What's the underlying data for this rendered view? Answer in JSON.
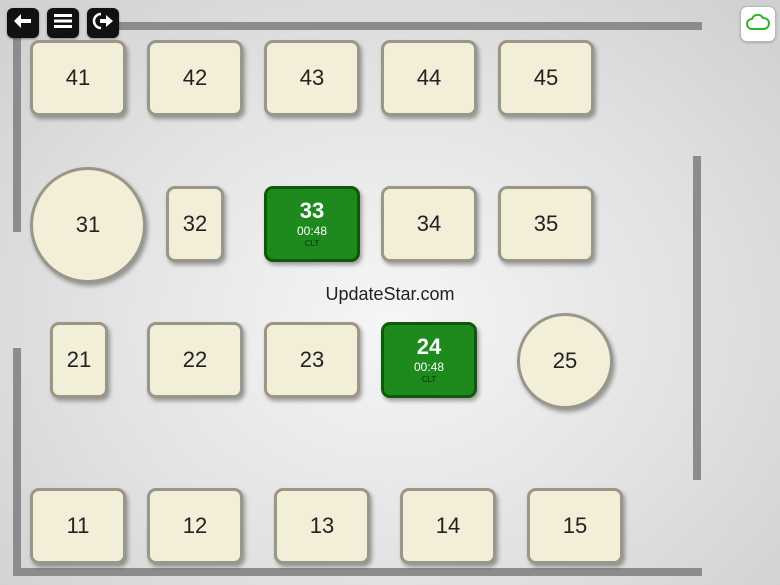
{
  "toolbar": {
    "back_icon": "back-arrow-icon",
    "menu_icon": "menu-icon",
    "exit_icon": "exit-icon",
    "sync_icon": "cloud-icon",
    "sync_color": "#2fb32f"
  },
  "watermark": "UpdateStar.com",
  "colors": {
    "table_free": "#f3eed7",
    "table_occupied": "#1e8a1e",
    "wall": "#8c8c8c"
  },
  "tables": {
    "t41": {
      "number": "41"
    },
    "t42": {
      "number": "42"
    },
    "t43": {
      "number": "43"
    },
    "t44": {
      "number": "44"
    },
    "t45": {
      "number": "45"
    },
    "t31": {
      "number": "31"
    },
    "t32": {
      "number": "32"
    },
    "t33": {
      "number": "33",
      "time": "00:48",
      "tag": "CLT"
    },
    "t34": {
      "number": "34"
    },
    "t35": {
      "number": "35"
    },
    "t21": {
      "number": "21"
    },
    "t22": {
      "number": "22"
    },
    "t23": {
      "number": "23"
    },
    "t24": {
      "number": "24",
      "time": "00:48",
      "tag": "CLT"
    },
    "t25": {
      "number": "25"
    },
    "t11": {
      "number": "11"
    },
    "t12": {
      "number": "12"
    },
    "t13": {
      "number": "13"
    },
    "t14": {
      "number": "14"
    },
    "t15": {
      "number": "15"
    }
  }
}
